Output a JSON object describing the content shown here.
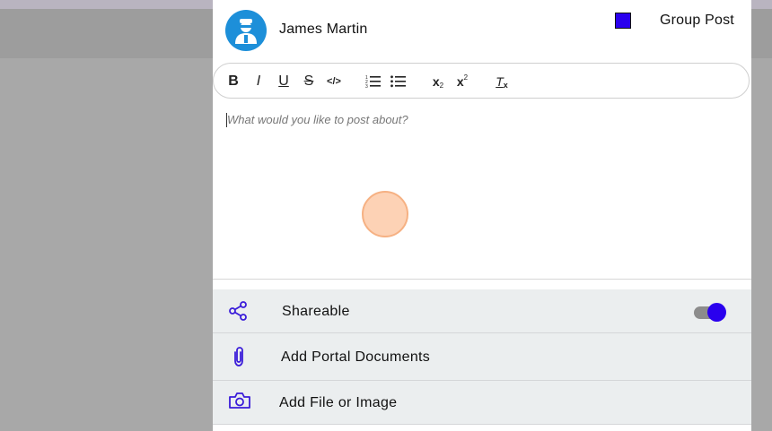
{
  "user": {
    "name": "James Martin",
    "avatar_icon": "user-avatar-icon"
  },
  "group_post": {
    "label": "Group Post",
    "checked": true
  },
  "toolbar": {
    "bold": "B",
    "italic": "I",
    "underline": "U",
    "strike": "S",
    "code": "</>",
    "ordered_list_icon": "ordered-list-icon",
    "bullet_list_icon": "bullet-list-icon",
    "subscript": "x",
    "subscript_mark": "2",
    "superscript": "x",
    "superscript_mark": "2",
    "clear_format": "T",
    "clear_format_mark": "x"
  },
  "editor": {
    "placeholder": "What would you like to post about?"
  },
  "options": {
    "shareable": {
      "label": "Shareable",
      "icon": "share-icon",
      "toggle_on": true
    },
    "portal_documents": {
      "label": "Add Portal Documents",
      "icon": "paperclip-icon"
    },
    "file_image": {
      "label": "Add File or Image",
      "icon": "camera-icon"
    }
  },
  "colors": {
    "accent": "#2a00ee",
    "avatar": "#1d8fd9",
    "touch": "#fdd2b5"
  }
}
